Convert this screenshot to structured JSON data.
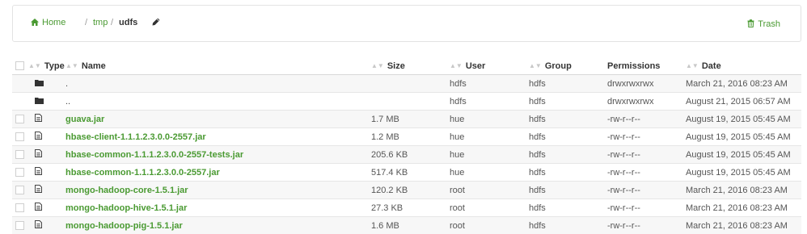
{
  "breadcrumb": {
    "home": "Home",
    "separator": "/",
    "tmp": "tmp",
    "current": "udfs"
  },
  "actions": {
    "trash": "Trash"
  },
  "table": {
    "headers": {
      "type": "Type",
      "name": "Name",
      "size": "Size",
      "user": "User",
      "group": "Group",
      "permissions": "Permissions",
      "date": "Date"
    },
    "rows": [
      {
        "kind": "folder",
        "name": ".",
        "size": "",
        "user": "hdfs",
        "group": "hdfs",
        "permissions": "drwxrwxrwx",
        "date": "March 21, 2016 08:23 AM"
      },
      {
        "kind": "folder",
        "name": "..",
        "size": "",
        "user": "hdfs",
        "group": "hdfs",
        "permissions": "drwxrwxrwx",
        "date": "August 21, 2015 06:57 AM"
      },
      {
        "kind": "file",
        "name": "guava.jar",
        "size": "1.7 MB",
        "user": "hue",
        "group": "hdfs",
        "permissions": "-rw-r--r--",
        "date": "August 19, 2015 05:45 AM"
      },
      {
        "kind": "file",
        "name": "hbase-client-1.1.1.2.3.0.0-2557.jar",
        "size": "1.2 MB",
        "user": "hue",
        "group": "hdfs",
        "permissions": "-rw-r--r--",
        "date": "August 19, 2015 05:45 AM"
      },
      {
        "kind": "file",
        "name": "hbase-common-1.1.1.2.3.0.0-2557-tests.jar",
        "size": "205.6 KB",
        "user": "hue",
        "group": "hdfs",
        "permissions": "-rw-r--r--",
        "date": "August 19, 2015 05:45 AM"
      },
      {
        "kind": "file",
        "name": "hbase-common-1.1.1.2.3.0.0-2557.jar",
        "size": "517.4 KB",
        "user": "hue",
        "group": "hdfs",
        "permissions": "-rw-r--r--",
        "date": "August 19, 2015 05:45 AM"
      },
      {
        "kind": "file",
        "name": "mongo-hadoop-core-1.5.1.jar",
        "size": "120.2 KB",
        "user": "root",
        "group": "hdfs",
        "permissions": "-rw-r--r--",
        "date": "March 21, 2016 08:23 AM"
      },
      {
        "kind": "file",
        "name": "mongo-hadoop-hive-1.5.1.jar",
        "size": "27.3 KB",
        "user": "root",
        "group": "hdfs",
        "permissions": "-rw-r--r--",
        "date": "March 21, 2016 08:23 AM"
      },
      {
        "kind": "file",
        "name": "mongo-hadoop-pig-1.5.1.jar",
        "size": "1.6 MB",
        "user": "root",
        "group": "hdfs",
        "permissions": "-rw-r--r--",
        "date": "March 21, 2016 08:23 AM"
      }
    ]
  },
  "colors": {
    "accent": "#4a9a32"
  }
}
